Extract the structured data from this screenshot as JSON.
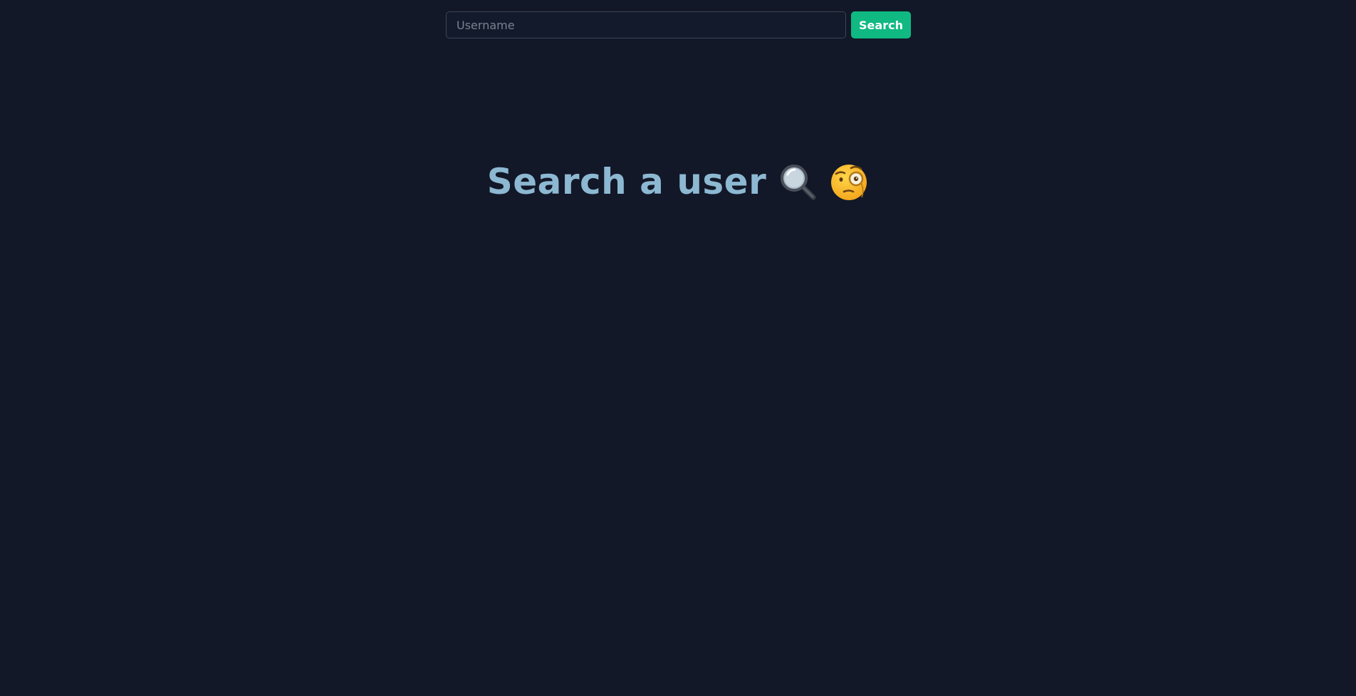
{
  "search": {
    "placeholder": "Username",
    "value": "",
    "button_label": "Search"
  },
  "headline": {
    "text": "Search a user",
    "icons": [
      "magnifying-glass-icon",
      "face-with-monocle-icon"
    ]
  },
  "colors": {
    "background": "#121828",
    "accent": "#10b981",
    "headline": "#8db8d2",
    "input_border": "#3b4456"
  }
}
